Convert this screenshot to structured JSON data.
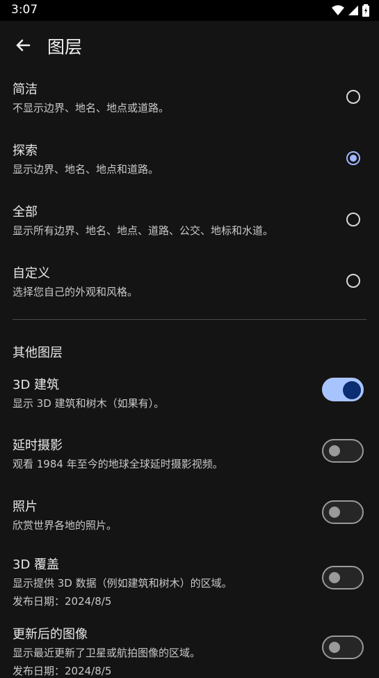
{
  "status": {
    "time": "3:07"
  },
  "header": {
    "title": "图层"
  },
  "map_types": [
    {
      "label": "简洁",
      "description": "不显示边界、地名、地点或道路。",
      "selected": false
    },
    {
      "label": "探索",
      "description": "显示边界、地名、地点和道路。",
      "selected": true
    },
    {
      "label": "全部",
      "description": "显示所有边界、地名、地点、道路、公交、地标和水道。",
      "selected": false
    },
    {
      "label": "自定义",
      "description": "选择您自己的外观和风格。",
      "selected": false
    }
  ],
  "other_layers": {
    "section_title": "其他图层",
    "items": [
      {
        "label": "3D 建筑",
        "description": "显示 3D 建筑和树木（如果有）。",
        "extra": "",
        "enabled": true
      },
      {
        "label": "延时摄影",
        "description": "观看 1984 年至今的地球全球延时摄影视频。",
        "extra": "",
        "enabled": false
      },
      {
        "label": "照片",
        "description": "欣赏世界各地的照片。",
        "extra": "",
        "enabled": false
      },
      {
        "label": "3D 覆盖",
        "description": "显示提供 3D 数据（例如建筑和树木）的区域。",
        "extra": "发布日期：2024/8/5",
        "enabled": false
      },
      {
        "label": "更新后的图像",
        "description": "显示最近更新了卫星或航拍图像的区域。",
        "extra": "发布日期：2024/8/5",
        "enabled": false
      }
    ]
  },
  "colors": {
    "accent": "#a8c4ff",
    "background": "#141414"
  }
}
